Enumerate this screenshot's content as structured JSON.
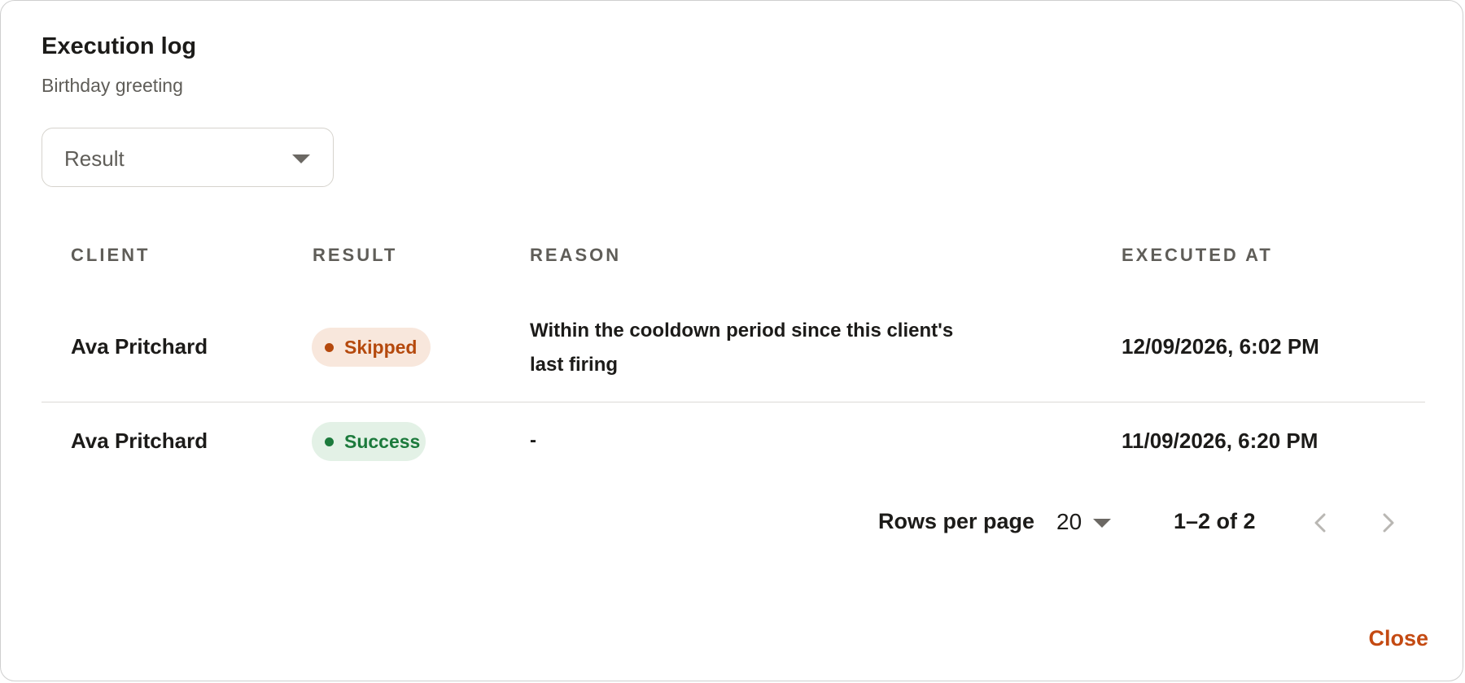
{
  "dialog": {
    "title": "Execution log",
    "subtitle": "Birthday greeting",
    "close_label": "Close"
  },
  "filter": {
    "placeholder": "Result",
    "icon": "caret-down-icon"
  },
  "table": {
    "columns": [
      "CLIENT",
      "RESULT",
      "REASON",
      "EXECUTED AT"
    ],
    "rows": [
      {
        "client": "Ava Pritchard",
        "result": "Skipped",
        "reason": "Within the cooldown period since this client's last firing",
        "executed_at": "12/09/2026, 6:02 PM"
      },
      {
        "client": "Ava Pritchard",
        "result": "Success",
        "reason": "-",
        "executed_at": "11/09/2026, 6:20 PM"
      }
    ]
  },
  "pagination": {
    "rows_per_page_label": "Rows per page",
    "rows_per_page_value": "20",
    "range": "1–2 of 2",
    "prev_icon": "chevron-left-icon",
    "next_icon": "chevron-right-icon"
  },
  "colors": {
    "accent": "#c44a12",
    "skipped_bg": "#f8e7dc",
    "skipped_text": "#b5490d",
    "success_bg": "#e3f1e6",
    "success_text": "#1c7a3c",
    "header_text": "#5f5d58"
  }
}
